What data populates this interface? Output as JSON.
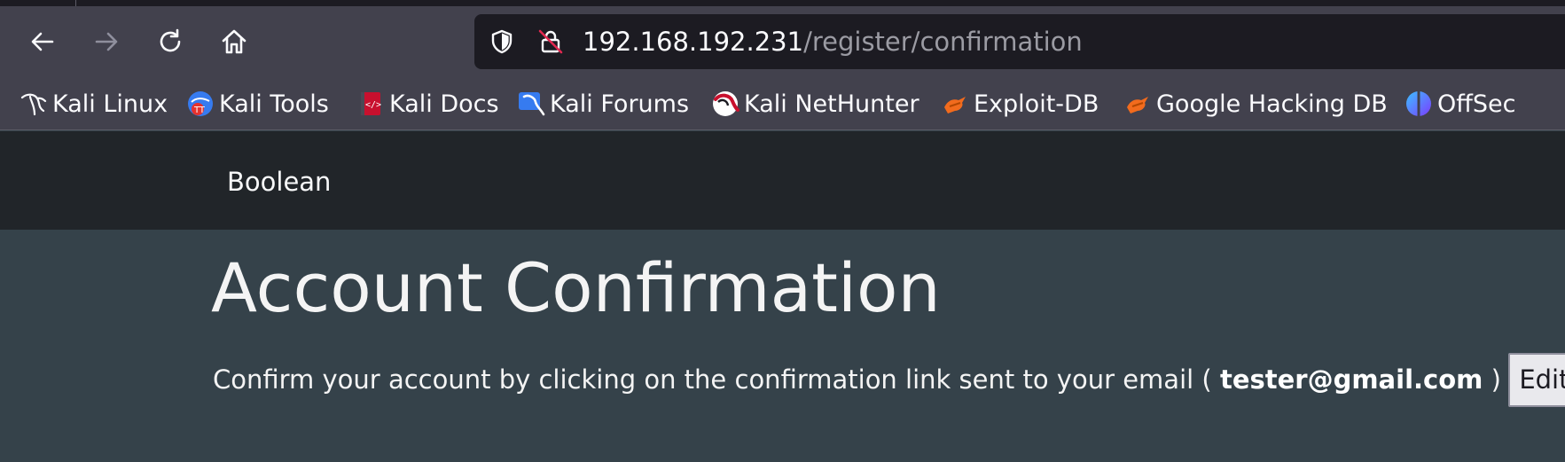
{
  "browser": {
    "url_host": "192.168.192.231",
    "url_path": "/register/confirmation",
    "bookmarks": [
      {
        "label": "Kali Linux",
        "icon": "kali-dragon-icon"
      },
      {
        "label": "Kali Tools",
        "icon": "kali-tools-icon"
      },
      {
        "label": "Kali Docs",
        "icon": "kali-docs-icon"
      },
      {
        "label": "Kali Forums",
        "icon": "kali-forums-icon"
      },
      {
        "label": "Kali NetHunter",
        "icon": "kali-nethunter-icon"
      },
      {
        "label": "Exploit-DB",
        "icon": "exploit-db-icon"
      },
      {
        "label": "Google Hacking DB",
        "icon": "google-hacking-db-icon"
      },
      {
        "label": "OffSec",
        "icon": "offsec-icon"
      }
    ]
  },
  "site": {
    "brand": "Boolean"
  },
  "main": {
    "title": "Account Confirmation",
    "message_prefix": "Confirm your account by clicking on the confirmation link sent to your email (",
    "email": "tester@gmail.com",
    "message_suffix": ")",
    "edit_label": "Edit"
  },
  "colors": {
    "toolbar": "#42414d",
    "urlbar": "#1c1b22",
    "navbar": "#212529",
    "content_bg": "#35424a"
  }
}
